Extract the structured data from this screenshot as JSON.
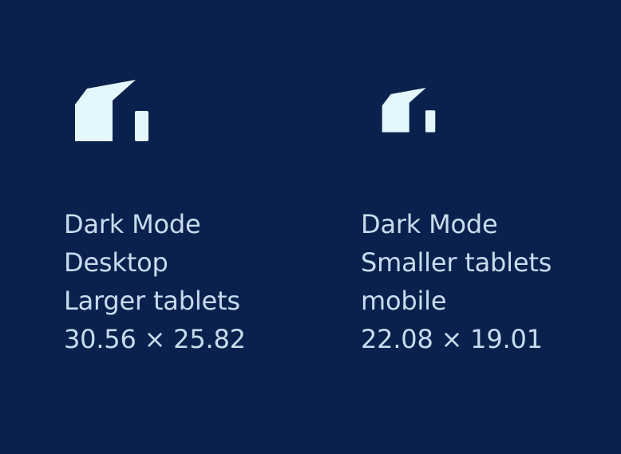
{
  "background_color": "#0b214d",
  "logo_color": "#e4f7fd",
  "text_color": "#c7dcee",
  "variants": [
    {
      "icon": "house-logo-icon",
      "lines": [
        "Dark Mode",
        "Desktop",
        "Larger tablets",
        "30.56 × 25.82"
      ]
    },
    {
      "icon": "house-logo-icon",
      "lines": [
        "Dark Mode",
        "Smaller tablets",
        "mobile",
        "22.08 × 19.01"
      ]
    }
  ]
}
